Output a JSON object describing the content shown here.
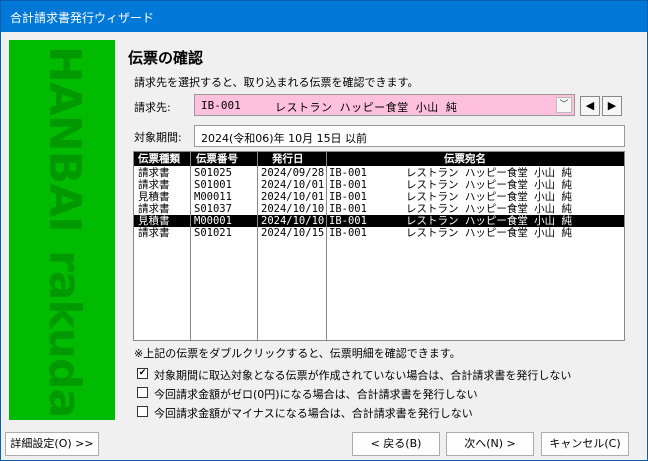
{
  "window": {
    "title": "合計請求書発行ウィザード"
  },
  "banner": {
    "word_top": "HANBAI",
    "word_bottom": "rakuda"
  },
  "page": {
    "heading": "伝票の確認",
    "description": "請求先を選択すると、取り込まれる伝票を確認できます。"
  },
  "customer": {
    "label": "請求先:",
    "code": "IB-001",
    "name": "レストラン ハッピー食堂 小山 純",
    "prev": "◀",
    "next": "▶"
  },
  "period": {
    "label": "対象期間:",
    "value": "2024(令和06)年 10月 15日 以前"
  },
  "grid": {
    "columns": [
      "伝票種類",
      "伝票番号",
      "発行日",
      "伝票宛名"
    ],
    "rows": [
      [
        "請求書",
        "S01025",
        "2024/09/28",
        "IB-001",
        "レストラン ハッピー食堂 小山 純"
      ],
      [
        "請求書",
        "S01001",
        "2024/10/01",
        "IB-001",
        "レストラン ハッピー食堂 小山 純"
      ],
      [
        "見積書",
        "M00011",
        "2024/10/01",
        "IB-001",
        "レストラン ハッピー食堂 小山 純"
      ],
      [
        "請求書",
        "S01037",
        "2024/10/10",
        "IB-001",
        "レストラン ハッピー食堂 小山 純"
      ],
      [
        "見積書",
        "M00001",
        "2024/10/10",
        "IB-001",
        "レストラン ハッピー食堂 小山 純"
      ],
      [
        "請求書",
        "S01021",
        "2024/10/15",
        "IB-001",
        "レストラン ハッピー食堂 小山 純"
      ]
    ],
    "selected_row": 4
  },
  "note": "※上記の伝票をダブルクリックすると、伝票明細を確認できます。",
  "options": [
    {
      "label": "対象期間に取込対象となる伝票が作成されていない場合は、合計請求書を発行しない",
      "checked": true
    },
    {
      "label": "今回請求金額がゼロ(0円)になる場合は、合計請求書を発行しない",
      "checked": false
    },
    {
      "label": "今回請求金額がマイナスになる場合は、合計請求書を発行しない",
      "checked": false
    }
  ],
  "buttons": {
    "details": "詳細設定(O) >>",
    "back": "< 戻る(B)",
    "next": "次へ(N) >",
    "cancel": "キャンセル(C)"
  }
}
